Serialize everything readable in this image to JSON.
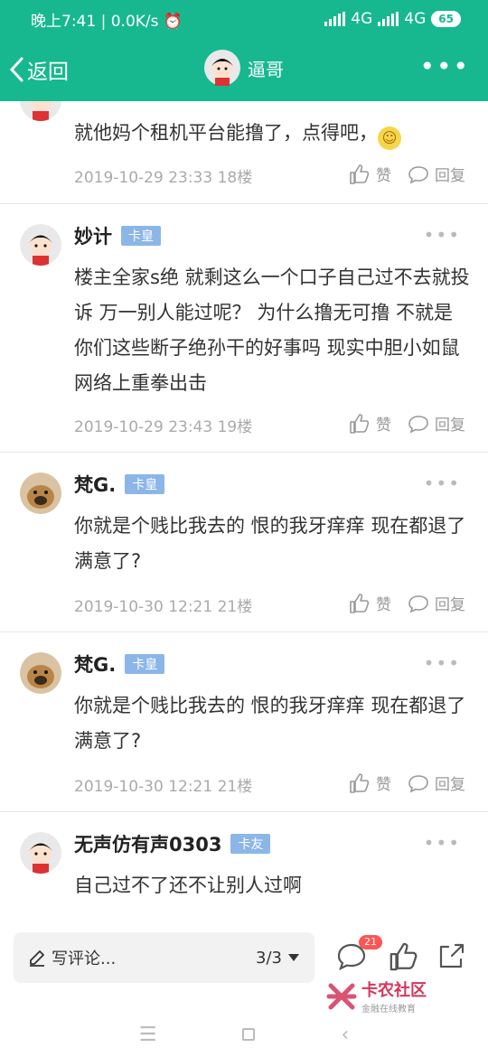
{
  "status": {
    "time": "晚上7:41",
    "speed": "0.0K/s",
    "net1": "4G",
    "net2": "4G",
    "battery": "65"
  },
  "nav": {
    "back_label": "返回",
    "title": "逼哥"
  },
  "posts": [
    {
      "text": "就他妈个租机平台能撸了，点得吧，",
      "meta": "2019-10-29 23:33  18楼",
      "like": "赞",
      "reply": "回复"
    },
    {
      "user": "妙计",
      "badge": "卡皇",
      "text": "楼主全家s绝  就剩这么一个口子自己过不去就投诉  万一别人能过呢？  为什么撸无可撸  不就是你们这些断子绝孙干的好事吗   现实中胆小如鼠  网络上重拳出击",
      "meta": "2019-10-29 23:43  19楼",
      "like": "赞",
      "reply": "回复"
    },
    {
      "user": "梵G.",
      "badge": "卡皇",
      "text": "你就是个贱比我去的 恨的我牙痒痒 现在都退了满意了?",
      "meta": "2019-10-30 12:21  21楼",
      "like": "赞",
      "reply": "回复"
    },
    {
      "user": "梵G.",
      "badge": "卡皇",
      "text": "你就是个贱比我去的 恨的我牙痒痒 现在都退了满意了?",
      "meta": "2019-10-30 12:21  21楼",
      "like": "赞",
      "reply": "回复"
    },
    {
      "user": "无声仿有声0303",
      "badge": "卡友",
      "text": "自己过不了还不让别人过啊"
    }
  ],
  "bottom": {
    "comment_placeholder": "写评论...",
    "page": "3/3",
    "comment_count": "21"
  },
  "watermark": {
    "name": "卡农社区",
    "slogan": "金融在线教育"
  },
  "icons": {
    "accent": "#17b890",
    "badge_color": "#8cb6e8"
  }
}
